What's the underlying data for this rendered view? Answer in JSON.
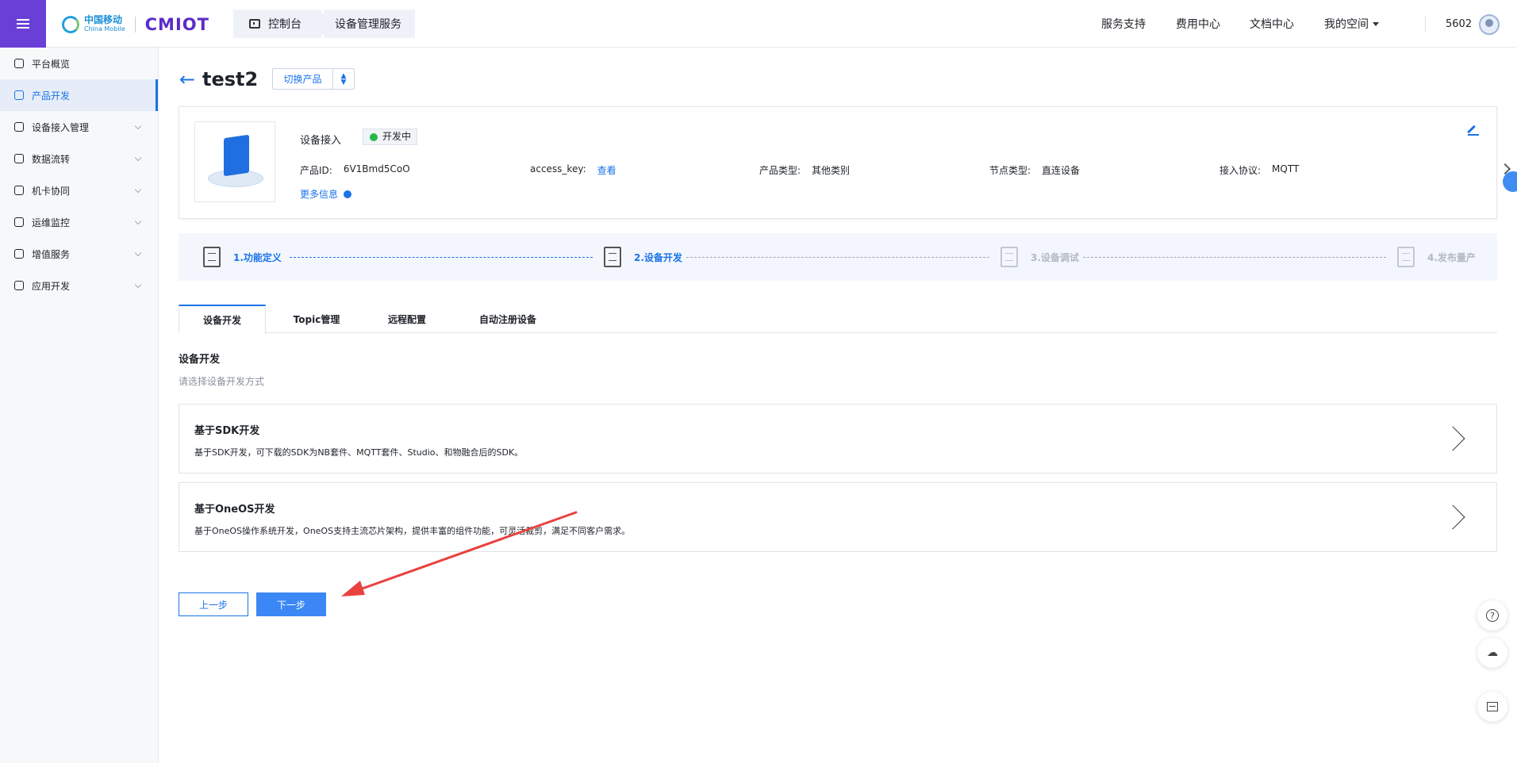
{
  "header": {
    "logo_cn": "中国移动",
    "logo_en": "China Mobile",
    "brand": "CMIOT",
    "breadcrumb": [
      "控制台",
      "设备管理服务"
    ],
    "nav": [
      {
        "label": "服务支持"
      },
      {
        "label": "费用中心"
      },
      {
        "label": "文档中心"
      },
      {
        "label": "我的空间"
      }
    ],
    "user_id": "5602"
  },
  "sidebar": {
    "items": [
      {
        "label": "平台概览",
        "icon": "overview-icon"
      },
      {
        "label": "产品开发",
        "icon": "product-icon",
        "active": true
      },
      {
        "label": "设备接入管理",
        "icon": "device-access-icon"
      },
      {
        "label": "数据流转",
        "icon": "data-flow-icon"
      },
      {
        "label": "机卡协同",
        "icon": "sim-card-icon"
      },
      {
        "label": "运维监控",
        "icon": "monitor-icon"
      },
      {
        "label": "增值服务",
        "icon": "value-added-icon"
      },
      {
        "label": "应用开发",
        "icon": "app-dev-icon"
      }
    ]
  },
  "product": {
    "name": "test2",
    "switch_label": "切换产品",
    "card_title": "设备接入",
    "status": "开发中",
    "status_color": "#28b84a",
    "meta": [
      {
        "key": "产品ID:",
        "value": "6V1Bmd5CoO"
      },
      {
        "key": "access_key:",
        "value": "查看",
        "is_link": true
      },
      {
        "key": "产品类型:",
        "value": "其他类别"
      },
      {
        "key": "节点类型:",
        "value": "直连设备"
      },
      {
        "key": "接入协议:",
        "value": "MQTT"
      }
    ],
    "more_info": "更多信息"
  },
  "steps": [
    {
      "label": "1.功能定义",
      "state": "done"
    },
    {
      "label": "2.设备开发",
      "state": "done"
    },
    {
      "label": "3.设备调试",
      "state": "todo"
    },
    {
      "label": "4.发布量产",
      "state": "todo"
    }
  ],
  "tabs": [
    {
      "label": "设备开发",
      "active": true
    },
    {
      "label": "Topic管理"
    },
    {
      "label": "远程配置"
    },
    {
      "label": "自动注册设备"
    }
  ],
  "section": {
    "title": "设备开发",
    "subtitle": "请选择设备开发方式"
  },
  "options": [
    {
      "title": "基于SDK开发",
      "desc": "基于SDK开发，可下载的SDK为NB套件、MQTT套件、Studio、和物融合后的SDK。"
    },
    {
      "title": "基于OneOS开发",
      "desc": "基于OneOS操作系统开发，OneOS支持主流芯片架构，提供丰富的组件功能，可灵活裁剪，满足不同客户需求。"
    }
  ],
  "buttons": {
    "prev": "上一步",
    "next": "下一步"
  },
  "colors": {
    "primary": "#1a73e8",
    "menu_bg": "#6a3fd8",
    "annotation_arrow": "#e8423f"
  }
}
